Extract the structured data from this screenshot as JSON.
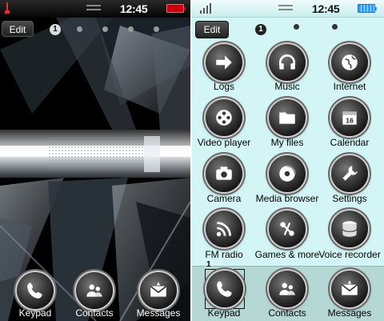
{
  "left_screen": {
    "status": {
      "time": "12:45"
    },
    "edit_label": "Edit",
    "page_indicator": {
      "current": "1",
      "dots": 5
    },
    "dock": [
      {
        "label": "Keypad",
        "icon": "phone-handset-icon"
      },
      {
        "label": "Contacts",
        "icon": "contacts-icon"
      },
      {
        "label": "Messages",
        "icon": "messages-icon"
      }
    ]
  },
  "right_screen": {
    "status": {
      "time": "12:45"
    },
    "edit_label": "Edit",
    "page_indicator": {
      "current": "1",
      "dots": 2
    },
    "apps": [
      {
        "label": "Logs",
        "icon": "arrow-right-icon"
      },
      {
        "label": "Music",
        "icon": "headphones-icon"
      },
      {
        "label": "Internet",
        "icon": "globe-icon"
      },
      {
        "label": "Video player",
        "icon": "film-reel-icon"
      },
      {
        "label": "My files",
        "icon": "folder-icon"
      },
      {
        "label": "Calendar",
        "icon": "calendar-icon"
      },
      {
        "label": "Camera",
        "icon": "camera-icon"
      },
      {
        "label": "Media browser",
        "icon": "media-disc-icon"
      },
      {
        "label": "Settings",
        "icon": "wrench-icon"
      },
      {
        "label": "FM radio",
        "icon": "radio-waves-icon"
      },
      {
        "label": "Games & more",
        "icon": "games-icon"
      },
      {
        "label": "Voice recorder",
        "icon": "voice-recorder-icon"
      }
    ],
    "selected_index": "1",
    "dock": [
      {
        "label": "Keypad",
        "icon": "phone-handset-icon"
      },
      {
        "label": "Contacts",
        "icon": "contacts-icon"
      },
      {
        "label": "Messages",
        "icon": "messages-icon"
      }
    ]
  },
  "colors": {
    "right_background": "#d3f5f5",
    "right_dock": "#b6d8d4",
    "battery_low": "#c80010",
    "battery_full": "#3a9af0"
  }
}
